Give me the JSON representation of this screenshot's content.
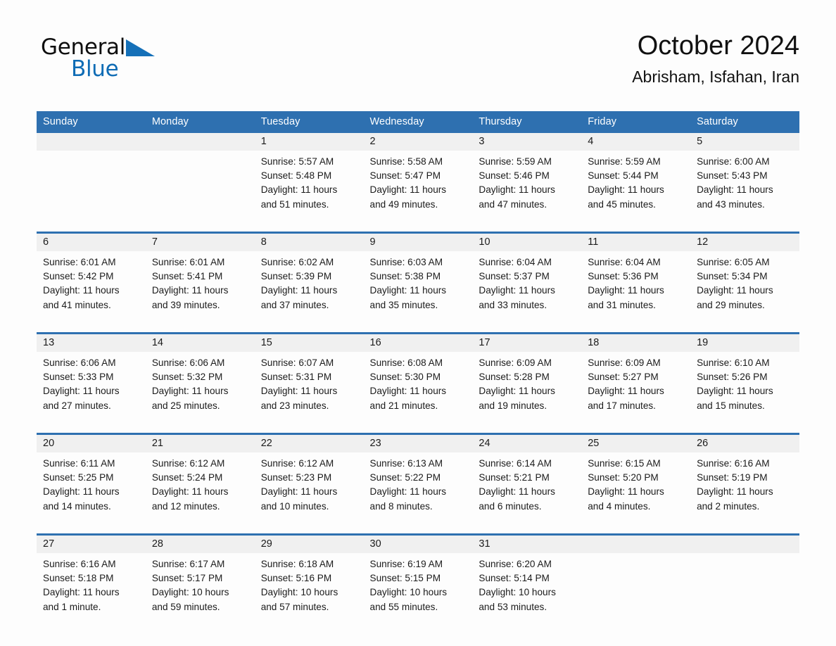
{
  "brand": {
    "word_one": "General",
    "word_two": "Blue",
    "triangle_color": "#1570b8",
    "text_color": "#0f0f0f"
  },
  "header": {
    "title": "October 2024",
    "subtitle": "Abrisham, Isfahan, Iran"
  },
  "theme": {
    "accent": "#2e70b0",
    "daynum_band": "#f0f0f0",
    "cell_bg": "#fdfdfd",
    "text": "#1b1b1b"
  },
  "calendar": {
    "weekday_headers": [
      "Sunday",
      "Monday",
      "Tuesday",
      "Wednesday",
      "Thursday",
      "Friday",
      "Saturday"
    ],
    "weeks": [
      [
        {
          "day": "",
          "sunrise": "",
          "sunset": "",
          "daylight_1": "",
          "daylight_2": ""
        },
        {
          "day": "",
          "sunrise": "",
          "sunset": "",
          "daylight_1": "",
          "daylight_2": ""
        },
        {
          "day": "1",
          "sunrise": "Sunrise: 5:57 AM",
          "sunset": "Sunset: 5:48 PM",
          "daylight_1": "Daylight: 11 hours",
          "daylight_2": "and 51 minutes."
        },
        {
          "day": "2",
          "sunrise": "Sunrise: 5:58 AM",
          "sunset": "Sunset: 5:47 PM",
          "daylight_1": "Daylight: 11 hours",
          "daylight_2": "and 49 minutes."
        },
        {
          "day": "3",
          "sunrise": "Sunrise: 5:59 AM",
          "sunset": "Sunset: 5:46 PM",
          "daylight_1": "Daylight: 11 hours",
          "daylight_2": "and 47 minutes."
        },
        {
          "day": "4",
          "sunrise": "Sunrise: 5:59 AM",
          "sunset": "Sunset: 5:44 PM",
          "daylight_1": "Daylight: 11 hours",
          "daylight_2": "and 45 minutes."
        },
        {
          "day": "5",
          "sunrise": "Sunrise: 6:00 AM",
          "sunset": "Sunset: 5:43 PM",
          "daylight_1": "Daylight: 11 hours",
          "daylight_2": "and 43 minutes."
        }
      ],
      [
        {
          "day": "6",
          "sunrise": "Sunrise: 6:01 AM",
          "sunset": "Sunset: 5:42 PM",
          "daylight_1": "Daylight: 11 hours",
          "daylight_2": "and 41 minutes."
        },
        {
          "day": "7",
          "sunrise": "Sunrise: 6:01 AM",
          "sunset": "Sunset: 5:41 PM",
          "daylight_1": "Daylight: 11 hours",
          "daylight_2": "and 39 minutes."
        },
        {
          "day": "8",
          "sunrise": "Sunrise: 6:02 AM",
          "sunset": "Sunset: 5:39 PM",
          "daylight_1": "Daylight: 11 hours",
          "daylight_2": "and 37 minutes."
        },
        {
          "day": "9",
          "sunrise": "Sunrise: 6:03 AM",
          "sunset": "Sunset: 5:38 PM",
          "daylight_1": "Daylight: 11 hours",
          "daylight_2": "and 35 minutes."
        },
        {
          "day": "10",
          "sunrise": "Sunrise: 6:04 AM",
          "sunset": "Sunset: 5:37 PM",
          "daylight_1": "Daylight: 11 hours",
          "daylight_2": "and 33 minutes."
        },
        {
          "day": "11",
          "sunrise": "Sunrise: 6:04 AM",
          "sunset": "Sunset: 5:36 PM",
          "daylight_1": "Daylight: 11 hours",
          "daylight_2": "and 31 minutes."
        },
        {
          "day": "12",
          "sunrise": "Sunrise: 6:05 AM",
          "sunset": "Sunset: 5:34 PM",
          "daylight_1": "Daylight: 11 hours",
          "daylight_2": "and 29 minutes."
        }
      ],
      [
        {
          "day": "13",
          "sunrise": "Sunrise: 6:06 AM",
          "sunset": "Sunset: 5:33 PM",
          "daylight_1": "Daylight: 11 hours",
          "daylight_2": "and 27 minutes."
        },
        {
          "day": "14",
          "sunrise": "Sunrise: 6:06 AM",
          "sunset": "Sunset: 5:32 PM",
          "daylight_1": "Daylight: 11 hours",
          "daylight_2": "and 25 minutes."
        },
        {
          "day": "15",
          "sunrise": "Sunrise: 6:07 AM",
          "sunset": "Sunset: 5:31 PM",
          "daylight_1": "Daylight: 11 hours",
          "daylight_2": "and 23 minutes."
        },
        {
          "day": "16",
          "sunrise": "Sunrise: 6:08 AM",
          "sunset": "Sunset: 5:30 PM",
          "daylight_1": "Daylight: 11 hours",
          "daylight_2": "and 21 minutes."
        },
        {
          "day": "17",
          "sunrise": "Sunrise: 6:09 AM",
          "sunset": "Sunset: 5:28 PM",
          "daylight_1": "Daylight: 11 hours",
          "daylight_2": "and 19 minutes."
        },
        {
          "day": "18",
          "sunrise": "Sunrise: 6:09 AM",
          "sunset": "Sunset: 5:27 PM",
          "daylight_1": "Daylight: 11 hours",
          "daylight_2": "and 17 minutes."
        },
        {
          "day": "19",
          "sunrise": "Sunrise: 6:10 AM",
          "sunset": "Sunset: 5:26 PM",
          "daylight_1": "Daylight: 11 hours",
          "daylight_2": "and 15 minutes."
        }
      ],
      [
        {
          "day": "20",
          "sunrise": "Sunrise: 6:11 AM",
          "sunset": "Sunset: 5:25 PM",
          "daylight_1": "Daylight: 11 hours",
          "daylight_2": "and 14 minutes."
        },
        {
          "day": "21",
          "sunrise": "Sunrise: 6:12 AM",
          "sunset": "Sunset: 5:24 PM",
          "daylight_1": "Daylight: 11 hours",
          "daylight_2": "and 12 minutes."
        },
        {
          "day": "22",
          "sunrise": "Sunrise: 6:12 AM",
          "sunset": "Sunset: 5:23 PM",
          "daylight_1": "Daylight: 11 hours",
          "daylight_2": "and 10 minutes."
        },
        {
          "day": "23",
          "sunrise": "Sunrise: 6:13 AM",
          "sunset": "Sunset: 5:22 PM",
          "daylight_1": "Daylight: 11 hours",
          "daylight_2": "and 8 minutes."
        },
        {
          "day": "24",
          "sunrise": "Sunrise: 6:14 AM",
          "sunset": "Sunset: 5:21 PM",
          "daylight_1": "Daylight: 11 hours",
          "daylight_2": "and 6 minutes."
        },
        {
          "day": "25",
          "sunrise": "Sunrise: 6:15 AM",
          "sunset": "Sunset: 5:20 PM",
          "daylight_1": "Daylight: 11 hours",
          "daylight_2": "and 4 minutes."
        },
        {
          "day": "26",
          "sunrise": "Sunrise: 6:16 AM",
          "sunset": "Sunset: 5:19 PM",
          "daylight_1": "Daylight: 11 hours",
          "daylight_2": "and 2 minutes."
        }
      ],
      [
        {
          "day": "27",
          "sunrise": "Sunrise: 6:16 AM",
          "sunset": "Sunset: 5:18 PM",
          "daylight_1": "Daylight: 11 hours",
          "daylight_2": "and 1 minute."
        },
        {
          "day": "28",
          "sunrise": "Sunrise: 6:17 AM",
          "sunset": "Sunset: 5:17 PM",
          "daylight_1": "Daylight: 10 hours",
          "daylight_2": "and 59 minutes."
        },
        {
          "day": "29",
          "sunrise": "Sunrise: 6:18 AM",
          "sunset": "Sunset: 5:16 PM",
          "daylight_1": "Daylight: 10 hours",
          "daylight_2": "and 57 minutes."
        },
        {
          "day": "30",
          "sunrise": "Sunrise: 6:19 AM",
          "sunset": "Sunset: 5:15 PM",
          "daylight_1": "Daylight: 10 hours",
          "daylight_2": "and 55 minutes."
        },
        {
          "day": "31",
          "sunrise": "Sunrise: 6:20 AM",
          "sunset": "Sunset: 5:14 PM",
          "daylight_1": "Daylight: 10 hours",
          "daylight_2": "and 53 minutes."
        },
        {
          "day": "",
          "sunrise": "",
          "sunset": "",
          "daylight_1": "",
          "daylight_2": ""
        },
        {
          "day": "",
          "sunrise": "",
          "sunset": "",
          "daylight_1": "",
          "daylight_2": ""
        }
      ]
    ]
  }
}
